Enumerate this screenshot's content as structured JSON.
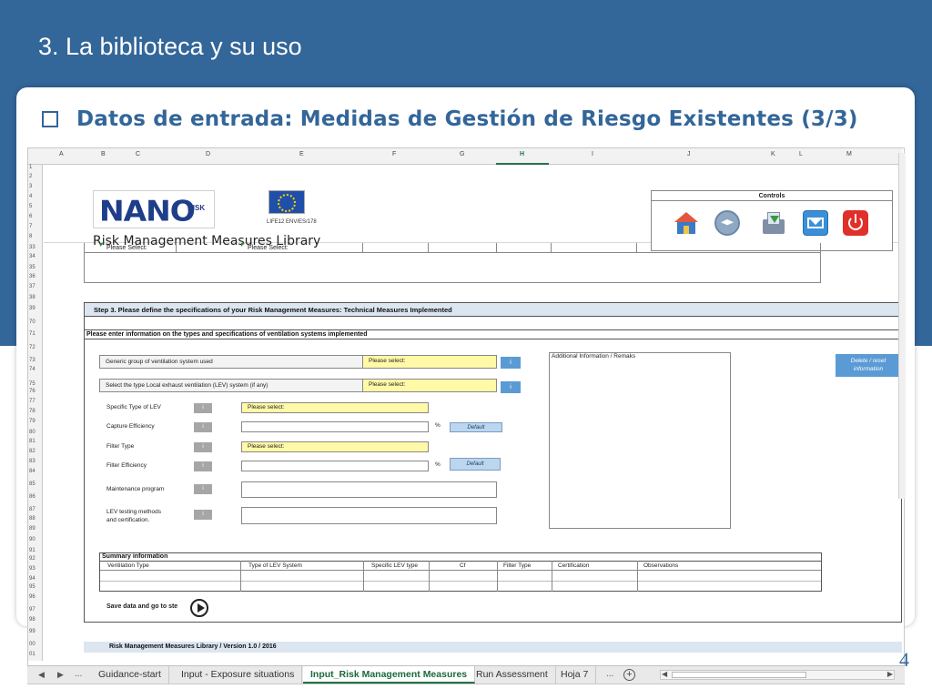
{
  "slide": {
    "title": "3. La biblioteca y su uso",
    "subtitle": "Datos de entrada: Medidas de Gestión de Riesgo Existentes (3/3)",
    "page_number": "4"
  },
  "colors": {
    "band": "#336699",
    "accent": "#5b9bd5",
    "input_yellow": "#fff9a8",
    "header_blue": "#dce6f1"
  },
  "sheet": {
    "columns": [
      "A",
      "B",
      "C",
      "D",
      "E",
      "F",
      "G",
      "H",
      "I",
      "J",
      "K",
      "L",
      "M"
    ],
    "selected_column": "H",
    "rows": [
      "1",
      "2",
      "3",
      "4",
      "5",
      "6",
      "7",
      "8",
      "33",
      "34",
      "35",
      "36",
      "37",
      "38",
      "39",
      "70",
      "71",
      "72",
      "73",
      "74",
      "75",
      "76",
      "77",
      "78",
      "79",
      "80",
      "81",
      "82",
      "83",
      "84",
      "85",
      "86",
      "87",
      "88",
      "89",
      "90",
      "91",
      "92",
      "93",
      "94",
      "95",
      "96",
      "97",
      "98",
      "99",
      "00",
      "01"
    ],
    "header": {
      "logo_text": "NANO",
      "logo_suffix": "RISK",
      "life_caption": "LIFE12 ENV/ES/178",
      "library_title": "Risk Management Measures Library",
      "controls_title": "Controls",
      "controls": [
        "home-icon",
        "help-icon",
        "save-icon",
        "mail-icon",
        "power-icon"
      ]
    },
    "please_select_1": "Please Select:",
    "please_select_2": "Please Select:",
    "step3": {
      "heading": "Step 3. Please define the specifications of your Risk Management Measures: Technical Measures Implemented",
      "subheading": "Please enter information on the types and specifications of ventilation systems implemented",
      "generic_group_label": "Generic group of ventilation system used",
      "generic_group_value": "Please select:",
      "lev_type_label": "Select the type Local exhaust ventilation (LEV) system (if any)",
      "lev_type_value": "Please select:",
      "info_button": "i",
      "additional_info_label": "Additional Information / Remaks",
      "delete_button": "Delete / reset information",
      "specific_type_label": "Specific Type of LEV",
      "specific_type_value": "Please select:",
      "capture_eff_label": "Capture Efficiency",
      "filter_type_label": "Filter Type",
      "filter_type_value": "Please select:",
      "filter_eff_label": "Filter Efficiency",
      "maintenance_label": "Maintenance program",
      "testing_label_1": "LEV testing methods",
      "testing_label_2": "and certification.",
      "percent": "%",
      "default_button": "Default",
      "summary_title": "Summary information",
      "summary_columns": [
        "Ventilation Type",
        "Type of LEV System",
        "Specific LEV type",
        "Cf",
        "Filter Type",
        "Certification",
        "Observations"
      ],
      "save_label": "Save data and go to ste"
    },
    "footer": "Risk Management Measures Library / Version 1.0 / 2016"
  },
  "tabs": {
    "nav_ellipsis": "...",
    "items": [
      "Guidance-start",
      "Input - Exposure situations",
      "Input_Risk Management Measures",
      "Run Assessment",
      "Hoja 7"
    ],
    "active": "Input_Risk Management Measures",
    "trailing_ellipsis": "..."
  }
}
